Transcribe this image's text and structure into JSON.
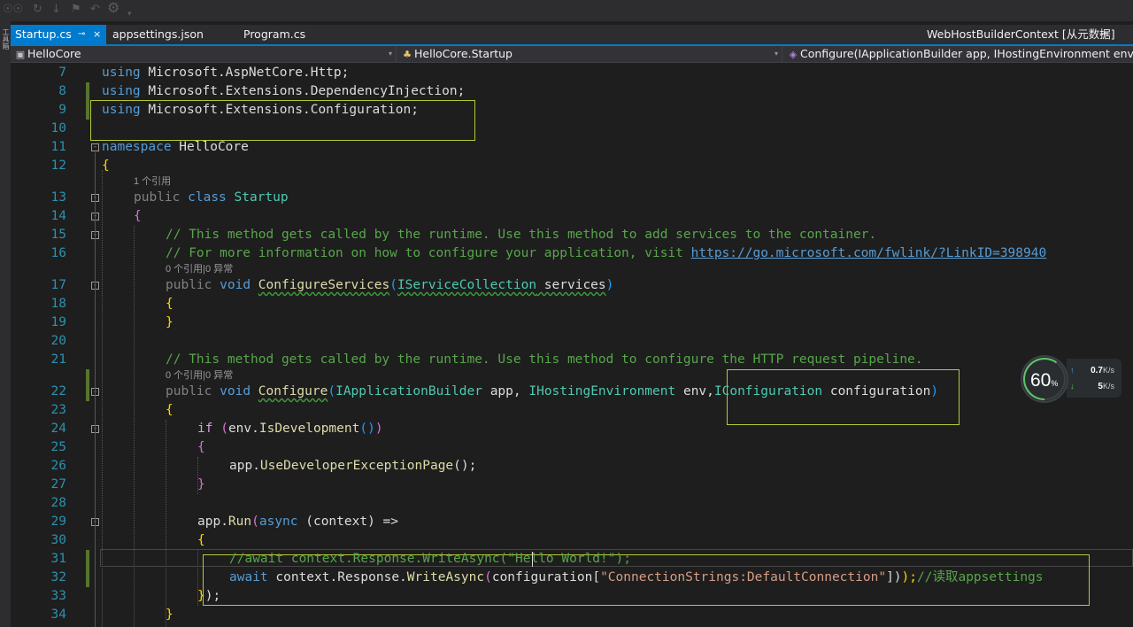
{
  "toolbar": {
    "icons": [
      "glasses-icon",
      "refresh-icon",
      "save-icon",
      "bookmark-icon",
      "undo-icon",
      "gear-icon",
      "chevron-down-icon"
    ]
  },
  "left_strip": {
    "label": "工具箱"
  },
  "tabs": [
    {
      "label": "Startup.cs",
      "active": true,
      "pin": "⊸",
      "close": "×"
    },
    {
      "label": "appsettings.json"
    },
    {
      "label": "Program.cs"
    },
    {
      "label": "WebHostBuilderContext [从元数据]",
      "pin": "⊸"
    }
  ],
  "navbar": {
    "project": "HelloCore",
    "class": "HelloCore.Startup",
    "member": "Configure(IApplicationBuilder app, IHostingEnvironment env, IC"
  },
  "code": {
    "line_numbers": [
      "7",
      "8",
      "9",
      "10",
      "11",
      "12",
      "13",
      "14",
      "15",
      "16",
      "17",
      "18",
      "19",
      "20",
      "21",
      "22",
      "23",
      "24",
      "25",
      "26",
      "27",
      "28",
      "29",
      "30",
      "31",
      "32",
      "33",
      "34"
    ],
    "l7": {
      "kw": "using",
      "rest": " Microsoft.AspNetCore.Http;"
    },
    "l8": {
      "kw": "using",
      "rest": " Microsoft.Extensions.DependencyInjection;"
    },
    "l9": {
      "kw": "using",
      "rest": " Microsoft.Extensions.Configuration;"
    },
    "l11": {
      "kw": "namespace",
      "rest": " HelloCore"
    },
    "l12": {
      "brace": "{"
    },
    "lens_class": "1 个引用",
    "l13": {
      "kw1": "public",
      "kw2": "class",
      "type": "Startup"
    },
    "l14": {
      "brace": "{"
    },
    "l15": {
      "comment": "// This method gets called by the runtime. Use this method to add services to the container."
    },
    "l16": {
      "comment": "// For more information on how to configure your application, visit ",
      "link": "https://go.microsoft.com/fwlink/?LinkID=398940"
    },
    "lens_cs": "0 个引用|0 异常",
    "l17": {
      "kw1": "public",
      "kw2": "void",
      "method": "ConfigureServices",
      "open": "(",
      "param_type": "IServiceCollection",
      "param": " services",
      "close": ")"
    },
    "l18": {
      "brace": "{"
    },
    "l19": {
      "brace": "}"
    },
    "l21": {
      "comment": "// This method gets called by the runtime. Use this method to configure the HTTP request pipeline."
    },
    "lens_c": "0 个引用|0 异常",
    "l22": {
      "kw1": "public",
      "kw2": "void",
      "method": "Configure",
      "open": "(",
      "t1": "IApplicationBuilder",
      "p1": " app, ",
      "t2": "IHostingEnvironment",
      "p2": " env,",
      "t3": "IConfiguration",
      "p3": " configuration",
      "close": ")"
    },
    "l23": {
      "brace": "{"
    },
    "l24": {
      "kw": "if",
      "open": " (",
      "rest": "env.",
      "method": "IsDevelopment",
      "paren": "()",
      "close": ")"
    },
    "l25": {
      "brace": "{"
    },
    "l26": {
      "pre": "app.",
      "method": "UseDeveloperExceptionPage",
      "post": "();"
    },
    "l27": {
      "brace": "}"
    },
    "l29": {
      "pre": "app.",
      "method": "Run",
      "open": "(",
      "kw": "async",
      "args": " (context) =>"
    },
    "l30": {
      "brace": "{"
    },
    "l31": {
      "comment": "//await context.Response.WriteAsync(\"Hello World!\");"
    },
    "l32": {
      "kw": "await",
      "pre": " context.Response.",
      "method": "WriteAsync",
      "open": "(",
      "obj": "configuration[",
      "str": "\"ConnectionStrings:DefaultConnection\"",
      "close1": "])",
      "close2": ");",
      "comment": "//读取appsettings"
    },
    "l33": {
      "brace": "}",
      "tail": ");"
    },
    "l34": {
      "brace": "}"
    }
  },
  "netmon": {
    "percent": "60",
    "percent_unit": "%",
    "up_value": "0.7",
    "up_unit": "K/s",
    "down_value": "5",
    "down_unit": "K/s",
    "up_arrow": "↑",
    "down_arrow": "↓"
  },
  "colors": {
    "accent": "#007acc",
    "keyword": "#569cd6",
    "type": "#4ec9b0",
    "comment": "#57a64a",
    "string": "#d69d85",
    "highlight_box": "#b5c938"
  }
}
